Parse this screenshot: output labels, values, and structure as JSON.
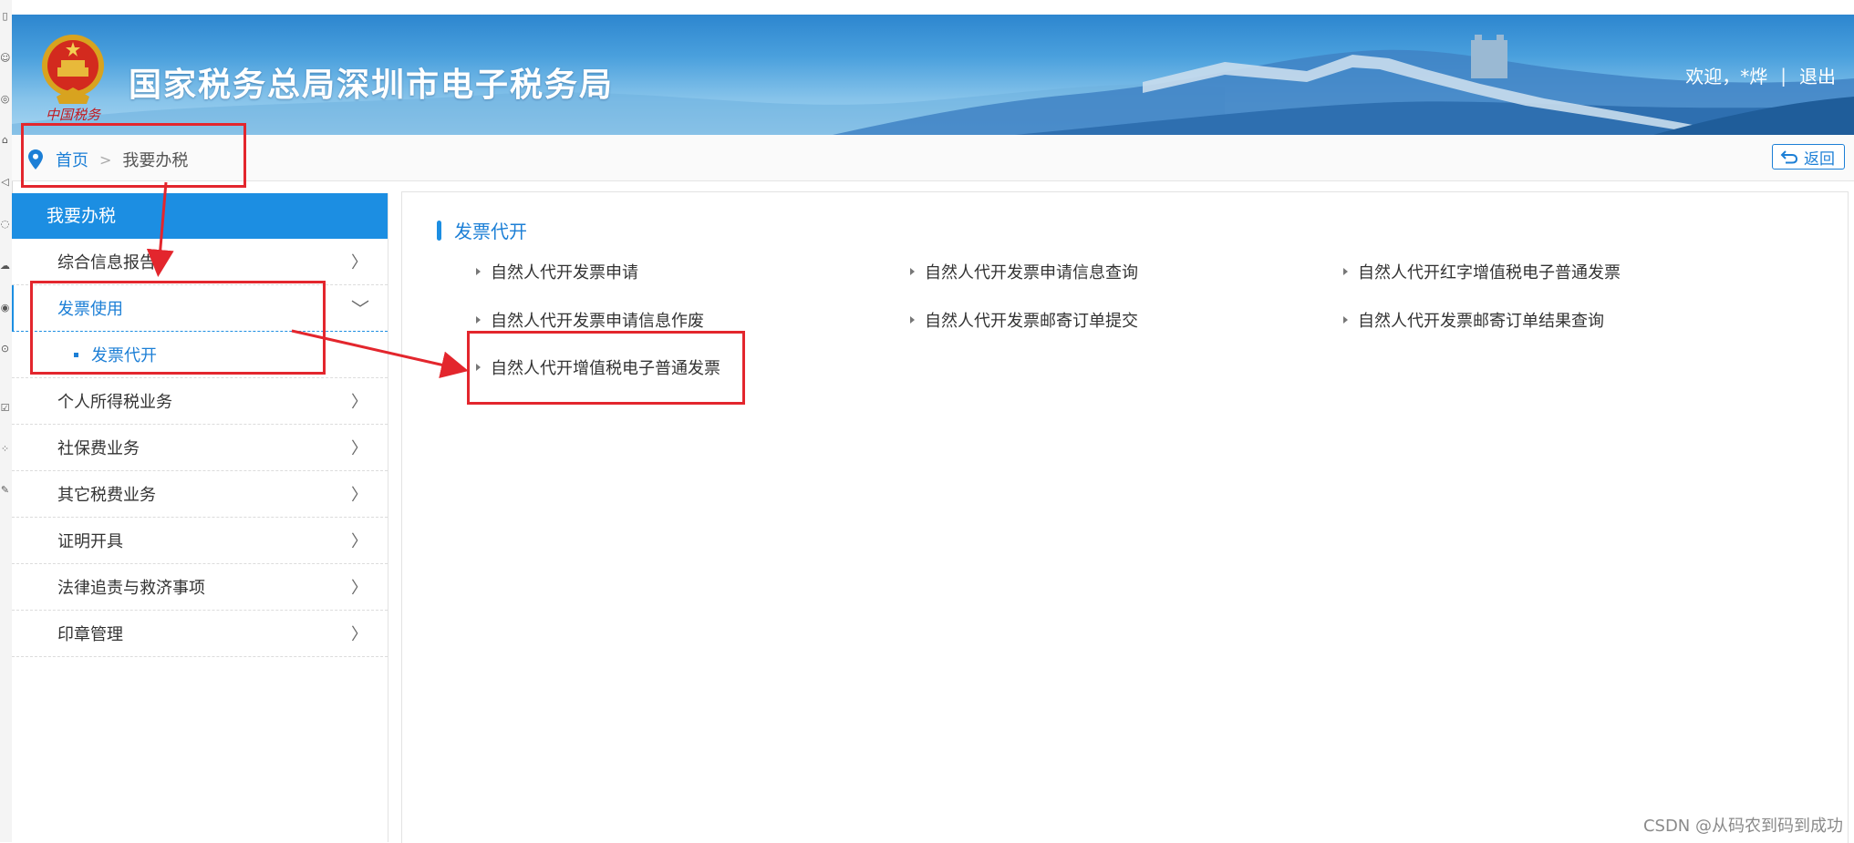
{
  "header": {
    "emblem_caption": "中国税务",
    "site_title": "国家税务总局深圳市电子税务局",
    "welcome": "欢迎，",
    "user_name": "*烨",
    "separator": "|",
    "logout": "退出"
  },
  "breadcrumb": {
    "home": "首页",
    "arrow": ">",
    "current": "我要办税",
    "back_label": "返回"
  },
  "sidebar": {
    "header": "我要办税",
    "items": [
      {
        "label": "综合信息报告",
        "chevron": "〉"
      },
      {
        "label": "发票使用",
        "chevron": "﹀",
        "expanded": true
      },
      {
        "label": "个人所得税业务",
        "chevron": "〉"
      },
      {
        "label": "社保费业务",
        "chevron": "〉"
      },
      {
        "label": "其它税费业务",
        "chevron": "〉"
      },
      {
        "label": "证明开具",
        "chevron": "〉"
      },
      {
        "label": "法律追责与救济事项",
        "chevron": "〉"
      },
      {
        "label": "印章管理",
        "chevron": "〉"
      }
    ],
    "sub_item": "发票代开"
  },
  "main": {
    "section_title": "发票代开",
    "links": [
      "自然人代开发票申请",
      "自然人代开发票申请信息查询",
      "自然人代开红字增值税电子普通发票",
      "自然人代开发票申请信息作废",
      "自然人代开发票邮寄订单提交",
      "自然人代开发票邮寄订单结果查询",
      "自然人代开增值税电子普通发票"
    ]
  },
  "watermark": "CSDN @从码农到码到成功",
  "colors": {
    "accent": "#1c8ee2",
    "link_blue": "#1c7fd6",
    "annotation_red": "#e3262d"
  }
}
